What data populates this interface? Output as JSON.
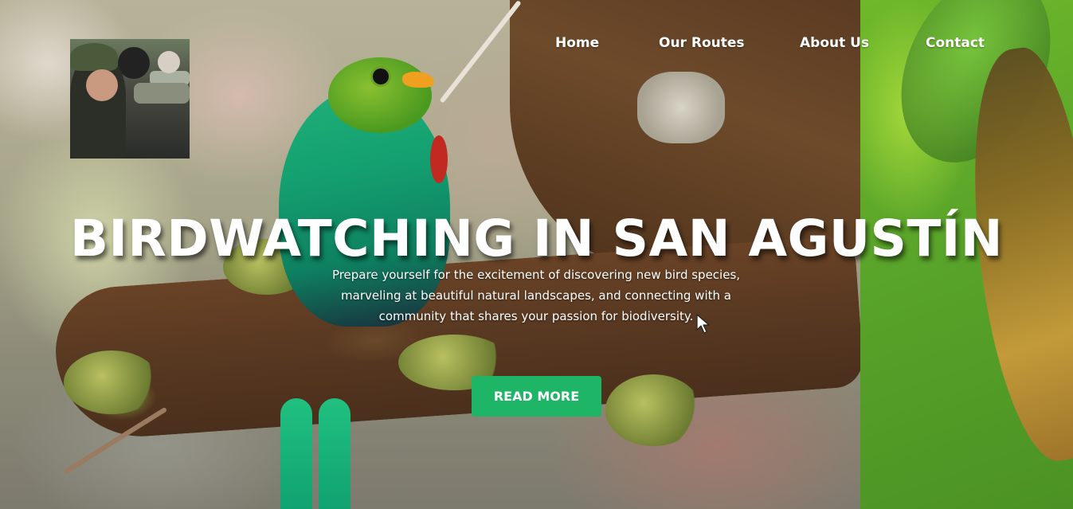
{
  "nav": {
    "items": [
      {
        "label": "Home"
      },
      {
        "label": "Our Routes"
      },
      {
        "label": "About Us"
      },
      {
        "label": "Contact"
      }
    ]
  },
  "hero": {
    "title": "BIRDWATCHING IN SAN AGUSTÍN",
    "subtitle": "Prepare yourself for the excitement of discovering new bird species, marveling at beautiful natural landscapes, and connecting with a community that shares your passion for biodiversity.",
    "cta_label": "READ MORE"
  },
  "colors": {
    "accent": "#1fb566",
    "text": "#ffffff"
  },
  "icons": {
    "cursor": "mouse-pointer-icon"
  }
}
